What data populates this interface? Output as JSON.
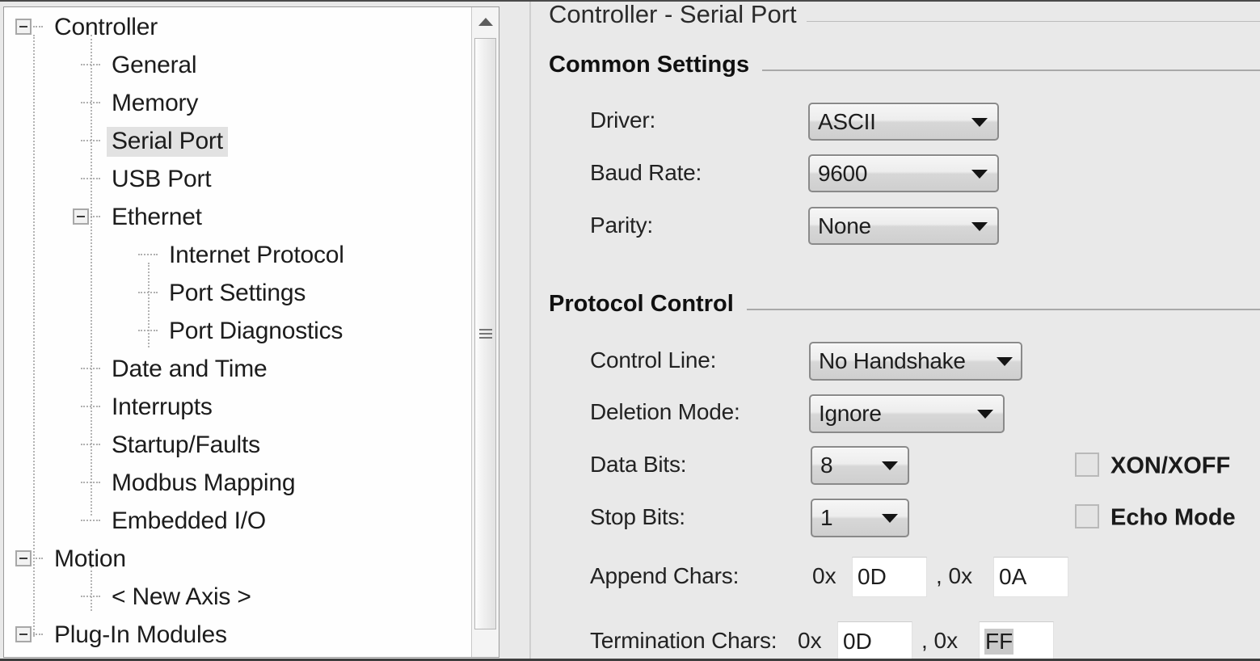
{
  "window": {
    "title": "Controller - Serial Port"
  },
  "tree": {
    "items": [
      {
        "label": "Controller",
        "depth": 0,
        "type": "expanded",
        "selected": false
      },
      {
        "label": "General",
        "depth": 1,
        "type": "leaf",
        "selected": false
      },
      {
        "label": "Memory",
        "depth": 1,
        "type": "leaf",
        "selected": false
      },
      {
        "label": "Serial Port",
        "depth": 1,
        "type": "leaf",
        "selected": true
      },
      {
        "label": "USB Port",
        "depth": 1,
        "type": "leaf",
        "selected": false
      },
      {
        "label": "Ethernet",
        "depth": 1,
        "type": "expanded",
        "selected": false
      },
      {
        "label": "Internet Protocol",
        "depth": 2,
        "type": "leaf",
        "selected": false
      },
      {
        "label": "Port Settings",
        "depth": 2,
        "type": "leaf",
        "selected": false
      },
      {
        "label": "Port Diagnostics",
        "depth": 2,
        "type": "leaf-last",
        "selected": false
      },
      {
        "label": "Date and Time",
        "depth": 1,
        "type": "leaf",
        "selected": false
      },
      {
        "label": "Interrupts",
        "depth": 1,
        "type": "leaf",
        "selected": false
      },
      {
        "label": "Startup/Faults",
        "depth": 1,
        "type": "leaf",
        "selected": false
      },
      {
        "label": "Modbus Mapping",
        "depth": 1,
        "type": "leaf",
        "selected": false
      },
      {
        "label": "Embedded I/O",
        "depth": 1,
        "type": "leaf-last",
        "selected": false
      },
      {
        "label": "Motion",
        "depth": 0,
        "type": "expanded",
        "selected": false
      },
      {
        "label": "< New Axis >",
        "depth": 1,
        "type": "leaf-last",
        "selected": false
      },
      {
        "label": "Plug-In Modules",
        "depth": 0,
        "type": "expanded",
        "selected": false
      }
    ],
    "scrollbar": {
      "up_arrow_icon": "scroll-up-arrow-icon",
      "grip_icon": "scrollbar-grip-icon"
    }
  },
  "content": {
    "page_title": "Controller - Serial Port",
    "groups": [
      {
        "title": "Common Settings",
        "fields": [
          {
            "label": "Driver:",
            "control": "combo",
            "value": "ASCII"
          },
          {
            "label": "Baud Rate:",
            "control": "combo",
            "value": "9600"
          },
          {
            "label": "Parity:",
            "control": "combo",
            "value": "None"
          }
        ]
      },
      {
        "title": "Protocol Control",
        "fields": [
          {
            "label": "Control Line:",
            "control": "combo",
            "value": "No Handshake"
          },
          {
            "label": "Deletion Mode:",
            "control": "combo",
            "value": "Ignore"
          },
          {
            "label": "Data Bits:",
            "control": "combo",
            "value": "8"
          },
          {
            "label": "Stop Bits:",
            "control": "combo",
            "value": "1"
          },
          {
            "label": "Append Chars:",
            "control": "hexpair",
            "hex_prefix_1": "0x",
            "value_1": "0D",
            "separator": ", 0x",
            "value_2": "0A",
            "value_2_selected": false
          },
          {
            "label": "Termination Chars:",
            "control": "hexpair",
            "hex_prefix_1": "0x",
            "value_1": "0D",
            "separator": ", 0x",
            "value_2": "FF",
            "value_2_selected": true
          }
        ]
      }
    ],
    "checkboxes": [
      {
        "label": "XON/XOFF",
        "checked": false
      },
      {
        "label": "Echo Mode",
        "checked": false
      }
    ]
  },
  "colors": {
    "panel_background": "#e9e9e9",
    "tree_background": "#ffffff",
    "selection": "#e2e2e2",
    "text": "#1c1c1c",
    "rule": "#a9a9a9"
  }
}
